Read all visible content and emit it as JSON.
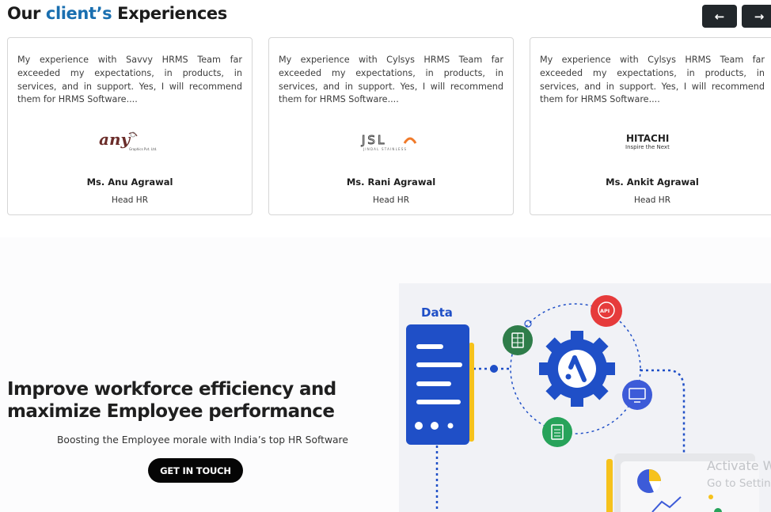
{
  "header": {
    "title_prefix": "Our",
    "title_accent": "client’s",
    "title_suffix": "Experiences",
    "prev_icon": "arrow-left-icon",
    "next_icon": "arrow-right-icon",
    "arrow_left": "←",
    "arrow_right": "→"
  },
  "testimonials": [
    {
      "quote": "My experience with Savvy HRMS Team far exceeded my expectations, in products, in services, and in support. Yes, I will recommend them for HRMS Software....",
      "logo_text": "any",
      "logo_subtext": "Graphics Pvt. Ltd.",
      "name": "Ms. Anu Agrawal",
      "role": "Head HR"
    },
    {
      "quote": "My experience with Cylsys HRMS Team far exceeded my expectations, in products, in services, and in support. Yes, I will recommend them for HRMS Software....",
      "logo_text": "JSL",
      "logo_subtext": "JINDAL STAINLESS",
      "name": "Ms. Rani Agrawal",
      "role": "Head HR"
    },
    {
      "quote": "My experience with Cylsys HRMS Team far exceeded my expectations, in products, in services, and in support. Yes, I will recommend them for HRMS Software....",
      "logo_text": "HITACHI",
      "logo_subtext": "Inspire the Next",
      "name": "Ms. Ankit Agrawal",
      "role": "Head HR"
    }
  ],
  "hero": {
    "title_line1": "Improve workforce efficiency and",
    "title_line2": "maximize Employee performance",
    "subtitle": "Boosting the Employee morale with India’s top HR Software",
    "cta_label": "GET IN TOUCH"
  },
  "illustration": {
    "data_label": "Data",
    "api_label": "API",
    "colors": {
      "server": "#1f4fc7",
      "gear": "#1f4fc7",
      "api": "#e63b3b",
      "sheet_dark": "#2f7d4a",
      "sheet_light": "#27a35a",
      "monitor": "#3d5bd8",
      "accent_yellow": "#f6c21c"
    }
  },
  "watermark": {
    "line1": "Activate W",
    "line2": "Go to Settin"
  }
}
